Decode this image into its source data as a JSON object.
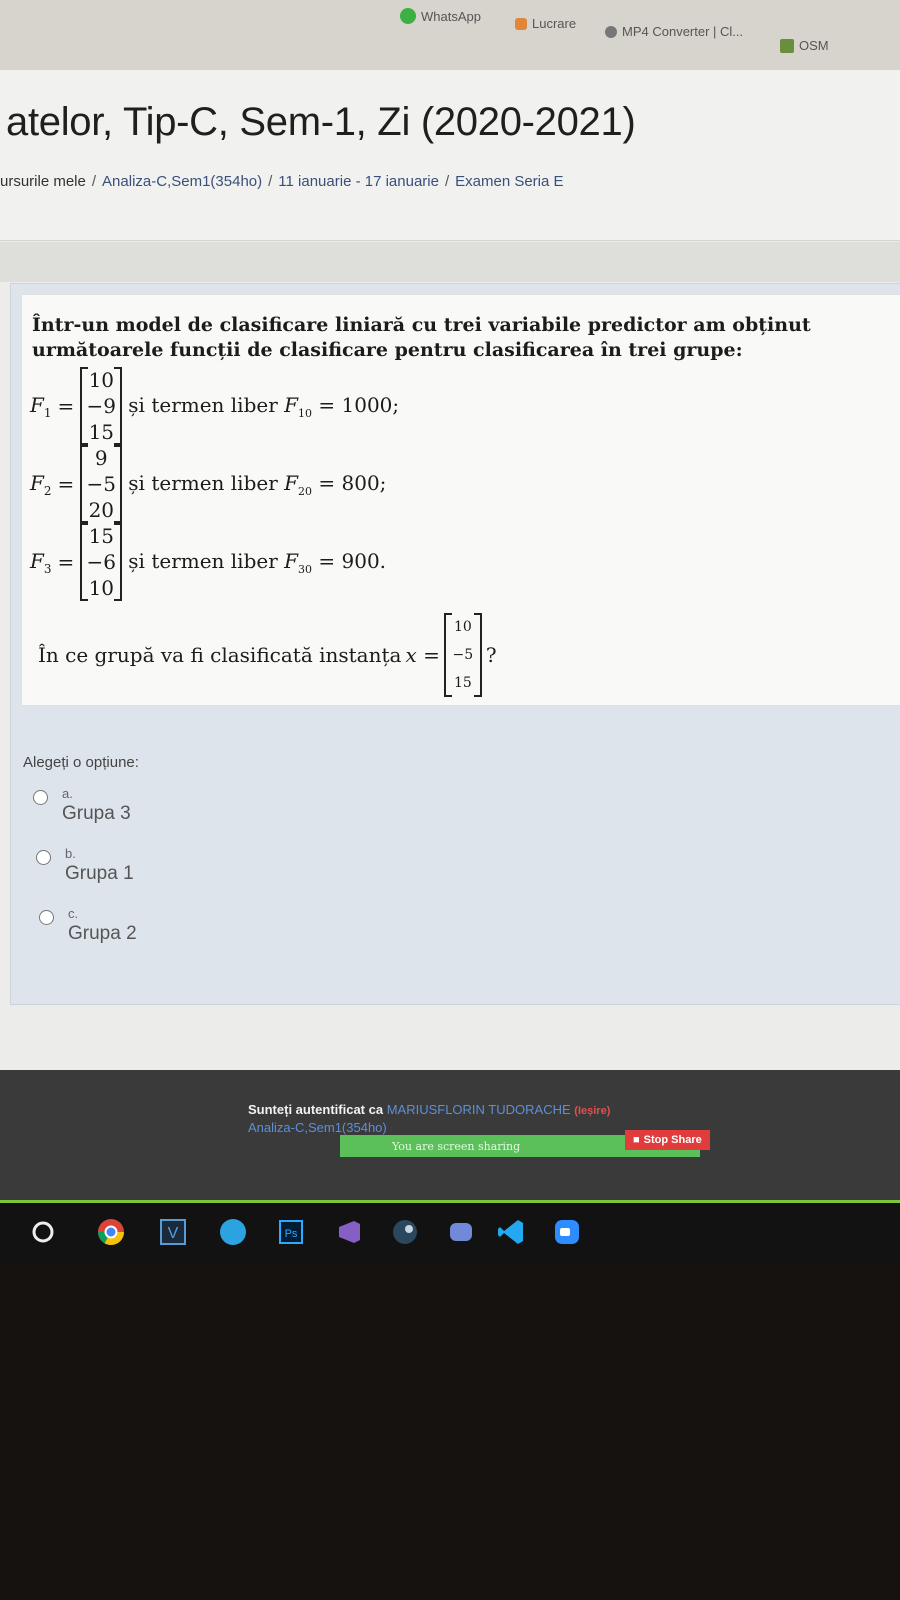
{
  "bookmarks": [
    {
      "label": "WhatsApp",
      "icon": "whatsapp-icon",
      "color": "#3cb043"
    },
    {
      "label": "Lucrare",
      "icon": "doc-icon",
      "color": "#e0873a"
    },
    {
      "label": "MP4 Converter | Cl...",
      "icon": "converter-icon",
      "color": "#555555"
    },
    {
      "label": "OSM",
      "icon": "osm-icon",
      "color": "#6a8f3c"
    }
  ],
  "course": {
    "title": "atelor, Tip-C, Sem-1, Zi (2020-2021)",
    "breadcrumb": [
      "ursurile mele",
      "Analiza-C,Sem1(354ho)",
      "11 ianuarie - 17 ianuarie",
      "Examen Seria E"
    ],
    "breadcrumb_sep": "/"
  },
  "question": {
    "stem": "Într-un model de clasificare liniară cu trei variabile predictor am obținut următoarele funcții de clasificare pentru clasificarea în trei grupe:",
    "functions": [
      {
        "name": "F",
        "index": "1",
        "vector": [
          "10",
          "−9",
          "15"
        ],
        "text": "și termen liber",
        "free_name": "F",
        "free_index": "10",
        "free_value": "= 1000;"
      },
      {
        "name": "F",
        "index": "2",
        "vector": [
          "9",
          "−5",
          "20"
        ],
        "text": "și termen liber",
        "free_name": "F",
        "free_index": "20",
        "free_value": "= 800;"
      },
      {
        "name": "F",
        "index": "3",
        "vector": [
          "15",
          "−6",
          "10"
        ],
        "text": "și termen liber",
        "free_name": "F",
        "free_index": "30",
        "free_value": "= 900."
      }
    ],
    "question_text": "În ce grupă va fi clasificată instanța",
    "instance_var": "x =",
    "instance_vector": [
      "10",
      "−5",
      "15"
    ],
    "question_end": "?",
    "prompt": "Alegeți o opțiune:",
    "options": [
      {
        "letter": "a.",
        "label": "Grupa 3"
      },
      {
        "letter": "b.",
        "label": "Grupa 1"
      },
      {
        "letter": "c.",
        "label": "Grupa 2"
      }
    ]
  },
  "footer": {
    "logged_in_text": "Sunteți autentificat ca",
    "user": "MARIUSFLORIN TUDORACHE",
    "logout": "(Ieșire)",
    "course_link": "Analiza-C,Sem1(354ho)",
    "screen_share_text": "You are screen sharing",
    "stop_share": "Stop Share"
  },
  "taskbar": {
    "icons": [
      "start-circle-icon",
      "chrome-icon",
      "vector-v-icon",
      "blue-circle-app-icon",
      "photoshop-icon",
      "visual-studio-icon",
      "steam-icon",
      "discord-icon",
      "vscode-icon",
      "zoom-icon"
    ]
  },
  "colors": {
    "accent_link": "#3a4f7a",
    "stop": "#e03c3c",
    "share_bar": "#5cc05a",
    "taskbar_accent": "#7ec53a"
  }
}
